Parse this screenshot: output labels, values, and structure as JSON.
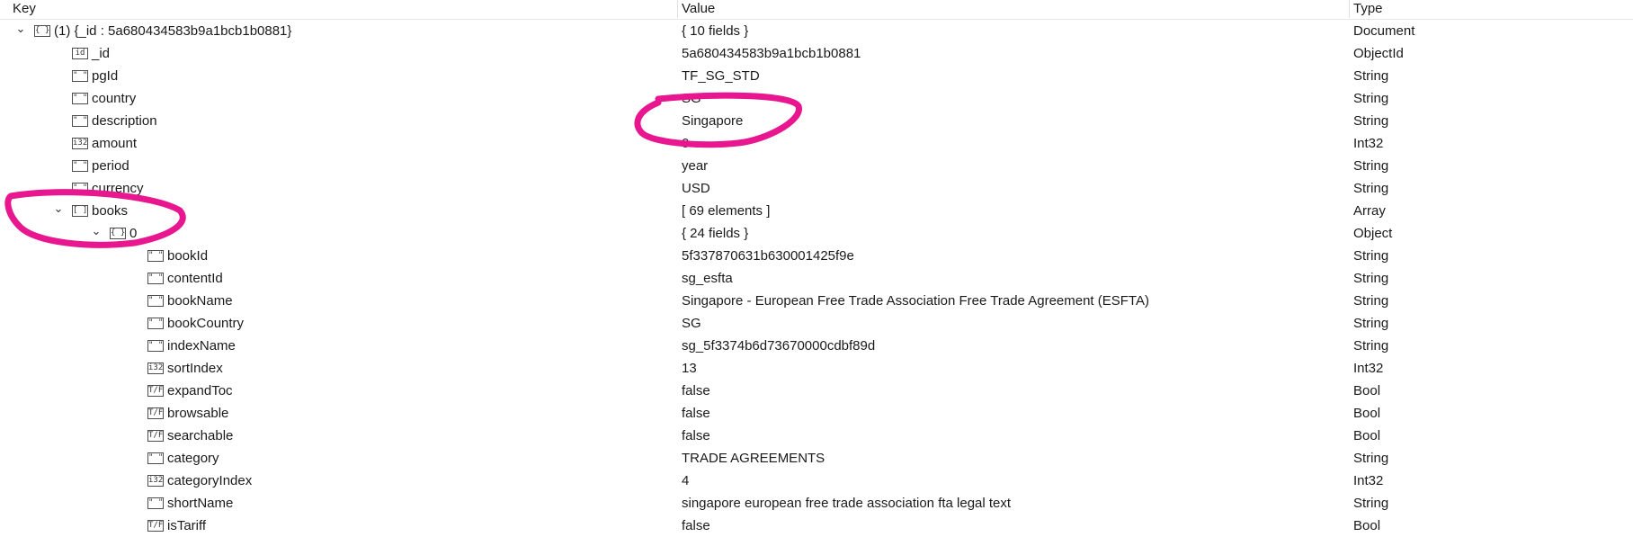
{
  "columns": {
    "key": "Key",
    "value": "Value",
    "type": "Type"
  },
  "rows": [
    {
      "key": "(1) {_id : 5a680434583b9a1bcb1b0881}",
      "value": "{ 10 fields }",
      "type": "Document",
      "icon": "object-icon",
      "iconText": "{ }",
      "expander": "expanded"
    },
    {
      "key": "_id",
      "value": "5a680434583b9a1bcb1b0881",
      "type": "ObjectId",
      "icon": "id-icon",
      "iconText": "id"
    },
    {
      "key": "pgId",
      "value": "TF_SG_STD",
      "type": "String",
      "icon": "string-icon",
      "iconText": "\" \""
    },
    {
      "key": "country",
      "value": "SG",
      "type": "String",
      "icon": "string-icon",
      "iconText": "\" \""
    },
    {
      "key": "description",
      "value": "Singapore",
      "type": "String",
      "icon": "string-icon",
      "iconText": "\" \""
    },
    {
      "key": "amount",
      "value": "0",
      "type": "Int32",
      "icon": "int32-icon",
      "iconText": "i32"
    },
    {
      "key": "period",
      "value": "year",
      "type": "String",
      "icon": "string-icon",
      "iconText": "\" \""
    },
    {
      "key": "currency",
      "value": "USD",
      "type": "String",
      "icon": "string-icon",
      "iconText": "\" \""
    },
    {
      "key": "books",
      "value": "[ 69 elements ]",
      "type": "Array",
      "icon": "array-icon",
      "iconText": "[ ]",
      "expander": "expanded"
    },
    {
      "key": "0",
      "value": "{ 24 fields }",
      "type": "Object",
      "icon": "object-icon",
      "iconText": "{ }",
      "expander": "expanded"
    },
    {
      "key": "bookId",
      "value": "5f337870631b630001425f9e",
      "type": "String",
      "icon": "string-icon",
      "iconText": "\" \""
    },
    {
      "key": "contentId",
      "value": "sg_esfta",
      "type": "String",
      "icon": "string-icon",
      "iconText": "\" \""
    },
    {
      "key": "bookName",
      "value": "Singapore - European Free Trade Association  Free Trade Agreement (ESFTA)",
      "type": "String",
      "icon": "string-icon",
      "iconText": "\" \""
    },
    {
      "key": "bookCountry",
      "value": "SG",
      "type": "String",
      "icon": "string-icon",
      "iconText": "\" \""
    },
    {
      "key": "indexName",
      "value": "sg_5f3374b6d73670000cdbf89d",
      "type": "String",
      "icon": "string-icon",
      "iconText": "\" \""
    },
    {
      "key": "sortIndex",
      "value": "13",
      "type": "Int32",
      "icon": "int32-icon",
      "iconText": "i32"
    },
    {
      "key": "expandToc",
      "value": "false",
      "type": "Bool",
      "icon": "bool-icon",
      "iconText": "T/F"
    },
    {
      "key": "browsable",
      "value": "false",
      "type": "Bool",
      "icon": "bool-icon",
      "iconText": "T/F"
    },
    {
      "key": "searchable",
      "value": "false",
      "type": "Bool",
      "icon": "bool-icon",
      "iconText": "T/F"
    },
    {
      "key": "category",
      "value": "TRADE AGREEMENTS",
      "type": "String",
      "icon": "string-icon",
      "iconText": "\" \""
    },
    {
      "key": "categoryIndex",
      "value": "4",
      "type": "Int32",
      "icon": "int32-icon",
      "iconText": "i32"
    },
    {
      "key": "shortName",
      "value": "singapore european free trade association fta legal text",
      "type": "String",
      "icon": "string-icon",
      "iconText": "\" \""
    },
    {
      "key": "isTariff",
      "value": "false",
      "type": "Bool",
      "icon": "bool-icon",
      "iconText": "T/F"
    }
  ],
  "annotation_color": "#e8168f"
}
